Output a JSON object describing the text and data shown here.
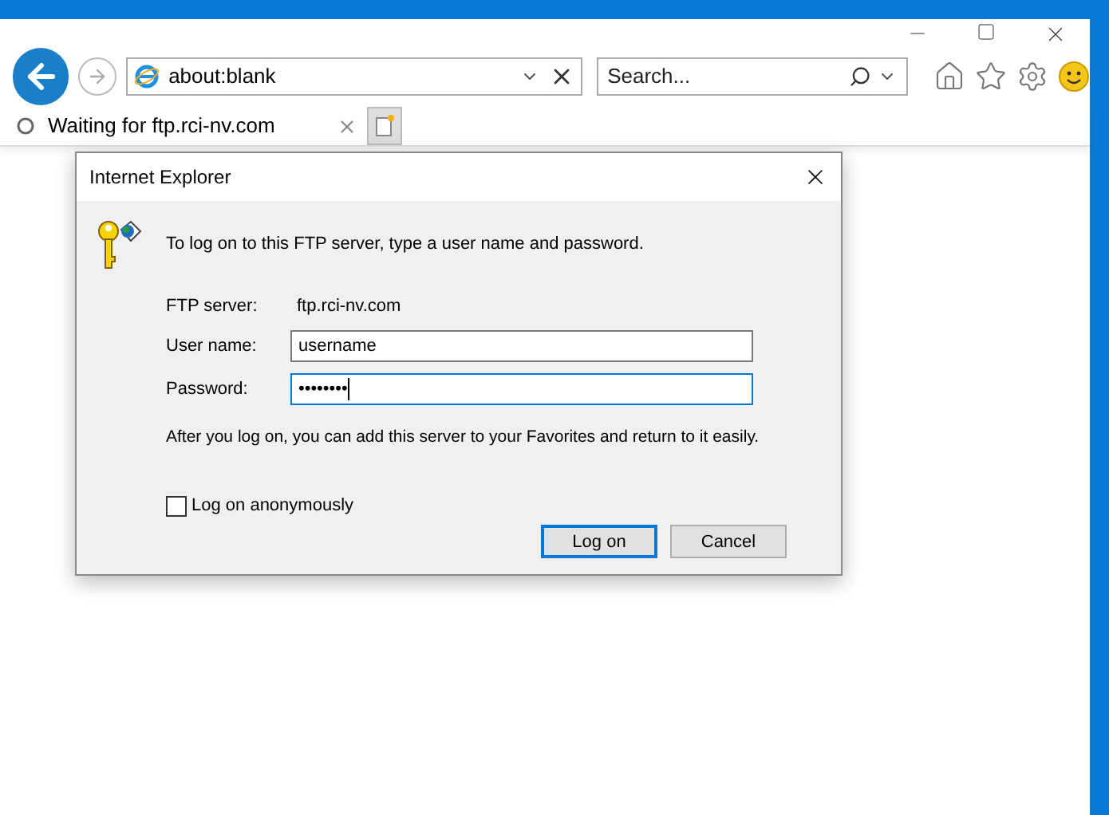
{
  "address_bar": {
    "value": "about:blank"
  },
  "search": {
    "placeholder": "Search..."
  },
  "tabs": [
    {
      "label": "Waiting for ftp.rci-nv.com",
      "selected": true
    }
  ],
  "dialog": {
    "title": "Internet Explorer",
    "message": "To log on to this FTP server, type a user name and password.",
    "server_label": "FTP server:",
    "server_value": "ftp.rci-nv.com",
    "fields": [
      {
        "label": "User name:",
        "value": "username",
        "focused": false
      },
      {
        "label": "Password:",
        "value": "••••••••",
        "focused": true
      }
    ],
    "note": "After you log on, you can add this server to your Favorites and return to it easily.",
    "checkbox": {
      "label": "Log on anonymously",
      "checked": false
    },
    "buttons": [
      {
        "label": "Log on",
        "default": true
      },
      {
        "label": "Cancel",
        "default": false
      }
    ]
  }
}
